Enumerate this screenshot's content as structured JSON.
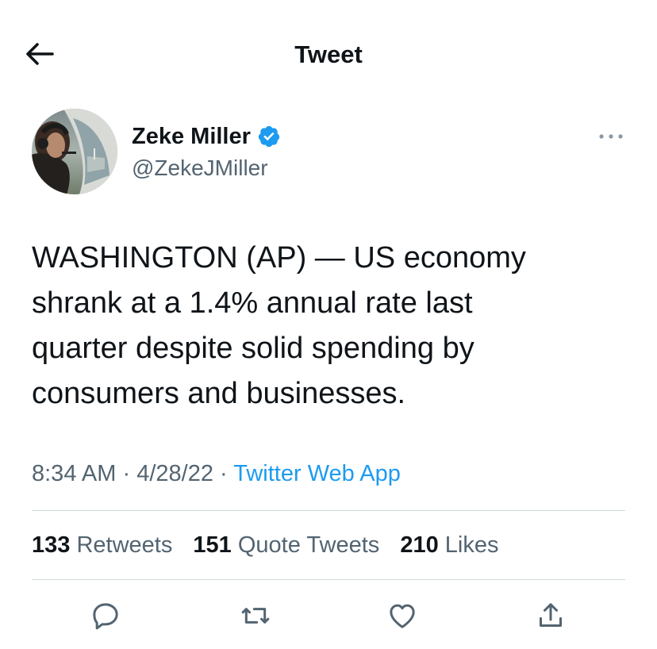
{
  "header": {
    "back_icon": "arrow-left-icon",
    "title": "Tweet"
  },
  "author": {
    "name": "Zeke Miller",
    "handle": "@ZekeJMiller",
    "verified": true,
    "verified_color": "#1d9bf0",
    "avatar": "profile-photo"
  },
  "tweet": {
    "text": "WASHINGTON (AP) — US economy\nshrank at a 1.4% annual rate last\nquarter despite solid spending by\nconsumers and businesses.",
    "time": "8:34 AM",
    "separator": "·",
    "date": "4/28/22",
    "source": "Twitter Web App"
  },
  "stats": {
    "retweets_count": "133",
    "retweets_label": "Retweets",
    "quotes_count": "151",
    "quotes_label": "Quote Tweets",
    "likes_count": "210",
    "likes_label": "Likes"
  },
  "actions": {
    "reply_icon": "reply-icon",
    "retweet_icon": "retweet-icon",
    "like_icon": "heart-icon",
    "share_icon": "share-icon"
  },
  "colors": {
    "text": "#0f1419",
    "secondary": "#536471",
    "link": "#1d9bf0",
    "divider": "#cfd9de"
  }
}
